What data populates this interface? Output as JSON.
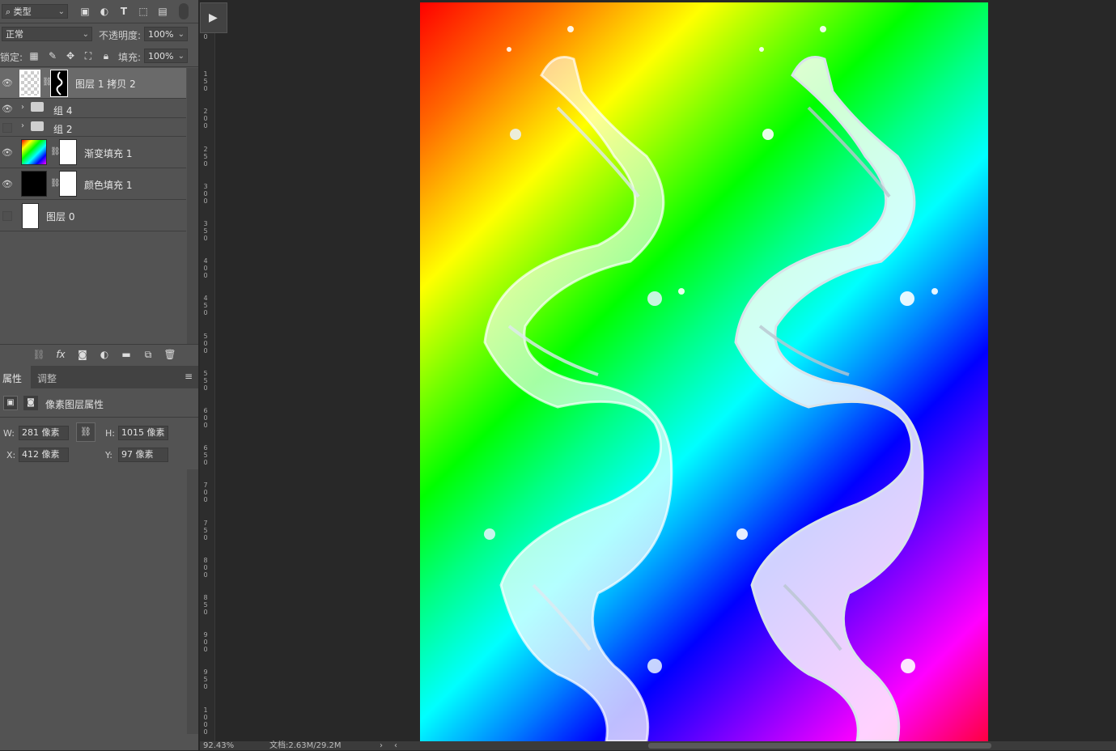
{
  "layers_panel": {
    "filter_type": "类型",
    "blend_mode": "正常",
    "opacity_label": "不透明度:",
    "opacity_value": "100%",
    "lock_label": "锁定:",
    "fill_label": "填充:",
    "fill_value": "100%",
    "layers": [
      {
        "name": "图层 1 拷贝 2",
        "visible": true,
        "selected": true
      },
      {
        "name": "组 4",
        "visible": true
      },
      {
        "name": "组 2",
        "visible": false
      },
      {
        "name": "渐变填充 1",
        "visible": true
      },
      {
        "name": "颜色填充 1",
        "visible": true
      },
      {
        "name": "图层 0",
        "visible": false
      }
    ]
  },
  "properties_panel": {
    "tabs": [
      "属性",
      "调整"
    ],
    "title": "像素图层属性",
    "w_label": "W:",
    "w_value": "281 像素",
    "h_label": "H:",
    "h_value": "1015 像素",
    "x_label": "X:",
    "x_value": "412 像素",
    "y_label": "Y:",
    "y_value": "97 像素"
  },
  "ruler_labels": [
    "0",
    "150",
    "200",
    "250",
    "300",
    "350",
    "400",
    "450",
    "500",
    "550",
    "600",
    "650",
    "700",
    "750",
    "800",
    "850",
    "900",
    "950",
    "1000",
    "1"
  ],
  "status": {
    "zoom": "92.43%",
    "doc": "文档:2.63M/29.2M"
  },
  "colors": {
    "panel": "#535353",
    "workspace": "#282828",
    "selected_layer": "#6a6a6a"
  }
}
